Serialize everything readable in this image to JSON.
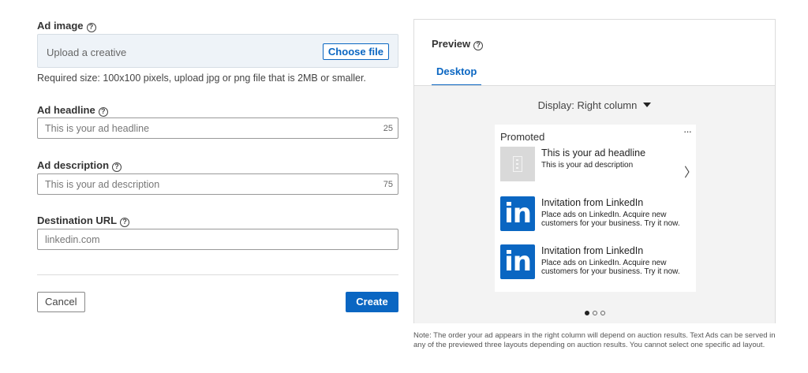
{
  "form": {
    "ad_image": {
      "label": "Ad image",
      "placeholder": "Upload a creative",
      "button": "Choose file",
      "hint": "Required size: 100x100 pixels, upload jpg or png file that is 2MB or smaller."
    },
    "headline": {
      "label": "Ad headline",
      "placeholder": "This is your ad headline",
      "count": "25"
    },
    "description": {
      "label": "Ad description",
      "placeholder": "This is your ad description",
      "count": "75"
    },
    "url": {
      "label": "Destination URL",
      "placeholder": "linkedin.com"
    },
    "cancel_label": "Cancel",
    "create_label": "Create"
  },
  "preview": {
    "title": "Preview",
    "tab": "Desktop",
    "display_select": "Display: Right column",
    "card": {
      "promoted": "Promoted",
      "more": "···",
      "next": "〉",
      "ads": [
        {
          "headline": "This is your ad headline",
          "description": "This is your ad description",
          "icon": "image-placeholder-icon"
        },
        {
          "headline": "Invitation from LinkedIn",
          "description": "Place ads on LinkedIn. Acquire new customers for your business. Try it now.",
          "icon": "linkedin-logo-icon",
          "logo_text": "in"
        },
        {
          "headline": "Invitation from LinkedIn",
          "description": "Place ads on LinkedIn. Acquire new customers for your business. Try it now.",
          "icon": "linkedin-logo-icon",
          "logo_text": "in"
        }
      ]
    },
    "pagination": {
      "total": 3,
      "active": 1
    },
    "note": "Note: The order your ad appears in the right column will depend on auction results. Text Ads can be served in any of the previewed three layouts depending on auction results. You cannot select one specific ad layout."
  },
  "colors": {
    "accent": "#0a66c2",
    "upload_bg": "#eef3f8",
    "preview_bg": "#f3f3f3"
  },
  "help_glyph": "?"
}
